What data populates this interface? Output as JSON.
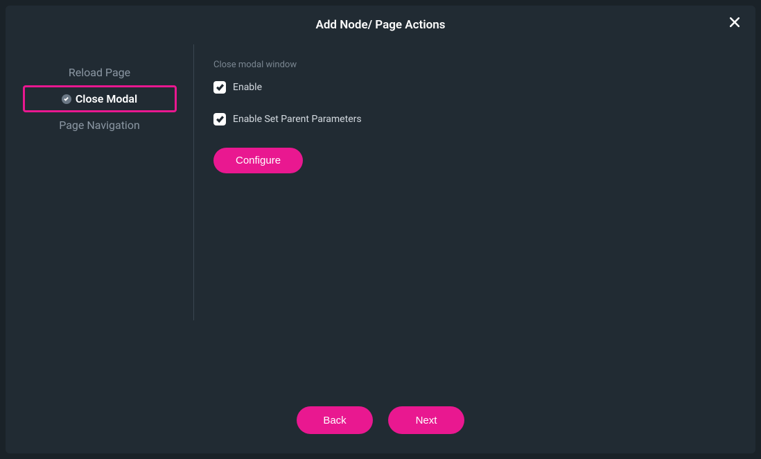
{
  "modal": {
    "title": "Add Node/ Page Actions"
  },
  "sidebar": {
    "items": [
      {
        "label": "Reload Page",
        "active": false,
        "highlighted": false,
        "showCheck": false
      },
      {
        "label": "Close Modal",
        "active": true,
        "highlighted": true,
        "showCheck": true
      },
      {
        "label": "Page Navigation",
        "active": false,
        "highlighted": false,
        "showCheck": false
      }
    ]
  },
  "content": {
    "sectionLabel": "Close modal window",
    "checkboxes": [
      {
        "label": "Enable",
        "checked": true
      },
      {
        "label": "Enable Set Parent Parameters",
        "checked": true
      }
    ],
    "configureLabel": "Configure"
  },
  "footer": {
    "backLabel": "Back",
    "nextLabel": "Next"
  }
}
